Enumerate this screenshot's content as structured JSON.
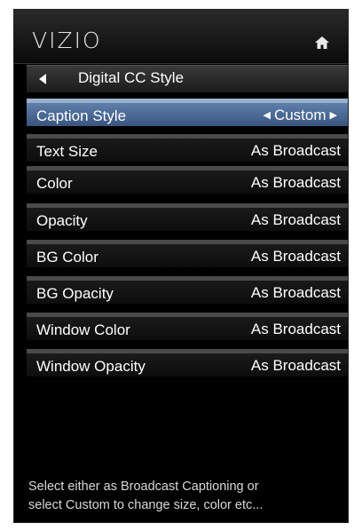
{
  "brand": {
    "logo": "VIZIO"
  },
  "header": {
    "title": "Digital CC Style"
  },
  "rows": [
    {
      "label": "Caption Style",
      "value": "Custom"
    },
    {
      "label": "Text Size",
      "value": "As Broadcast"
    },
    {
      "label": "Color",
      "value": "As Broadcast"
    },
    {
      "label": "Opacity",
      "value": "As Broadcast"
    },
    {
      "label": "BG Color",
      "value": "As Broadcast"
    },
    {
      "label": "BG Opacity",
      "value": "As Broadcast"
    },
    {
      "label": "Window Color",
      "value": "As Broadcast"
    },
    {
      "label": "Window Opacity",
      "value": "As Broadcast"
    }
  ],
  "help": {
    "line1": "Select either as Broadcast Captioning or",
    "line2": "select Custom to change size, color etc..."
  },
  "colors": {
    "selected": "#4f6e98",
    "background": "#000000",
    "text": "#ffffff"
  }
}
